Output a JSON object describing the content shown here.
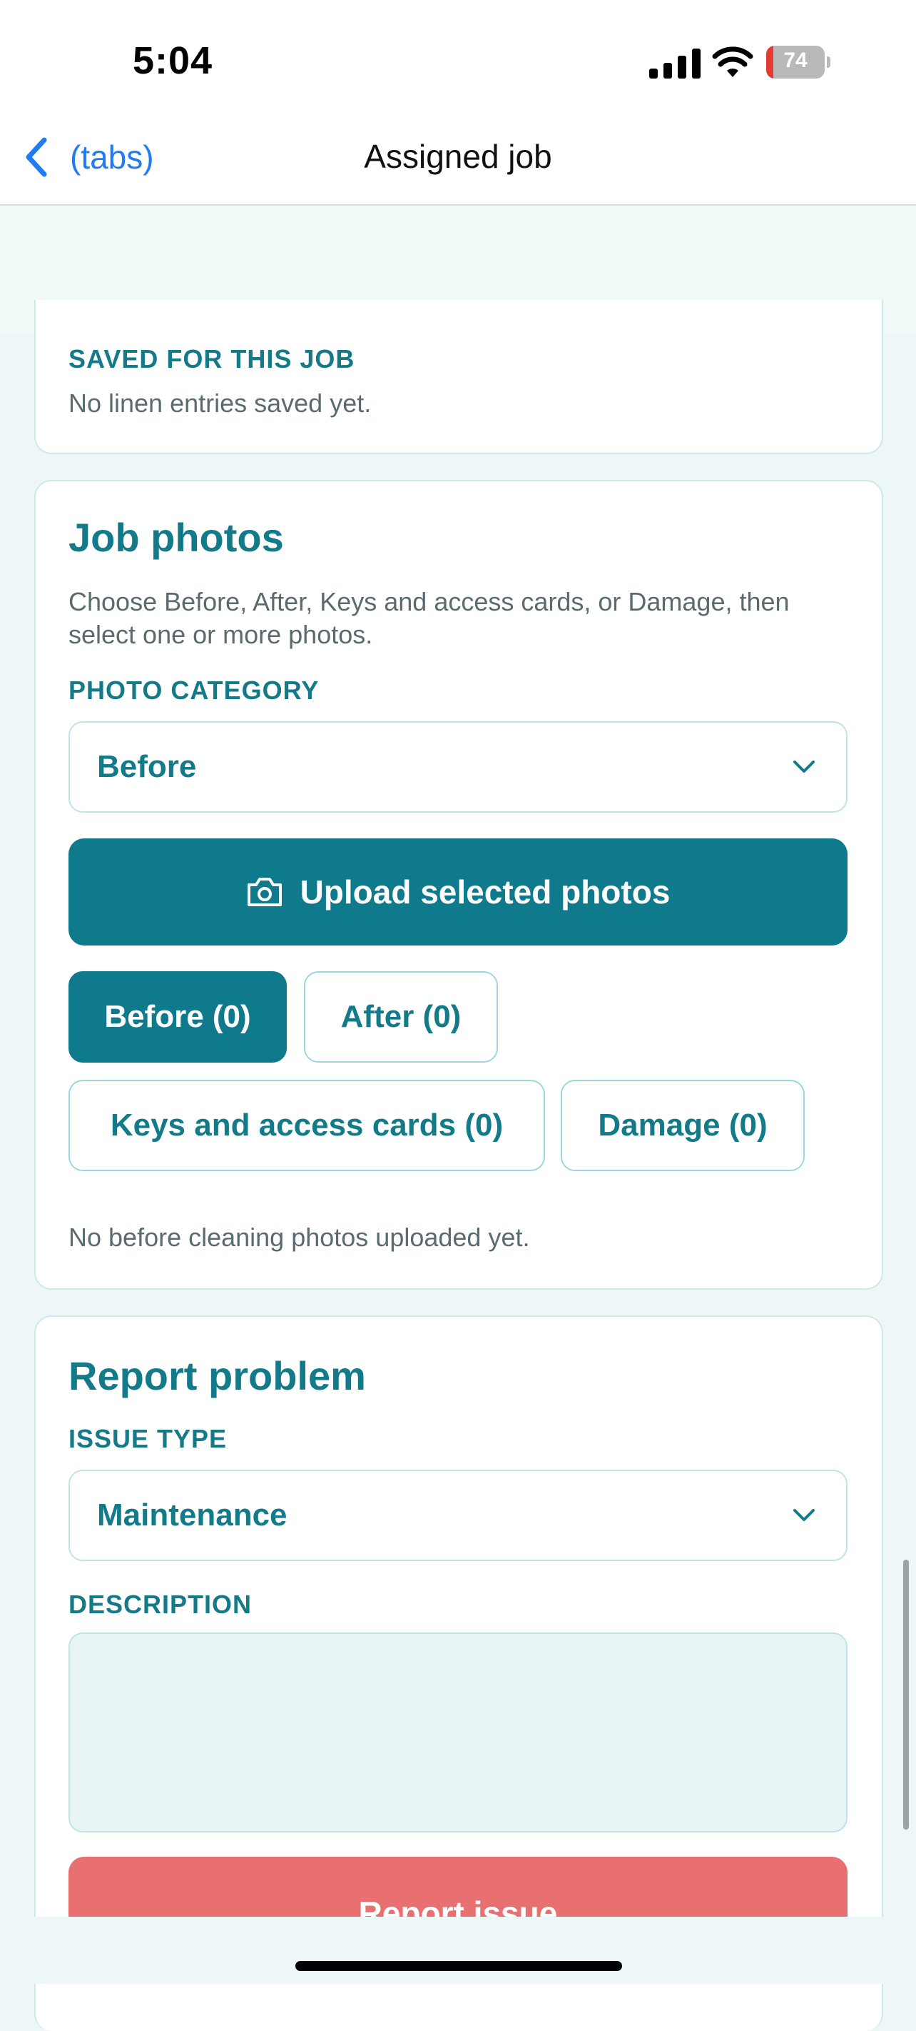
{
  "status_bar": {
    "time": "5:04",
    "battery": "74"
  },
  "nav": {
    "back_label": "(tabs)",
    "title": "Assigned job"
  },
  "saved_section": {
    "heading": "SAVED FOR THIS JOB",
    "empty_text": "No linen entries saved yet."
  },
  "job_photos": {
    "title": "Job photos",
    "description": "Choose Before, After, Keys and access cards, or Damage, then select one or more photos.",
    "category_label": "PHOTO CATEGORY",
    "category_value": "Before",
    "upload_label": "Upload selected photos",
    "chips": [
      {
        "label": "Before (0)",
        "active": true
      },
      {
        "label": "After (0)",
        "active": false
      },
      {
        "label": "Keys and access cards (0)",
        "active": false
      },
      {
        "label": "Damage (0)",
        "active": false
      }
    ],
    "empty_text": "No before cleaning photos uploaded yet."
  },
  "report_problem": {
    "title": "Report problem",
    "issue_label": "ISSUE TYPE",
    "issue_value": "Maintenance",
    "description_label": "DESCRIPTION",
    "description_value": "",
    "submit_label": "Report issue"
  },
  "colors": {
    "accent": "#0f7a8b",
    "link": "#1f7cf2",
    "danger": "#e97070"
  },
  "icons": [
    "chevron-left-icon",
    "chevron-down-icon",
    "camera-icon",
    "cellular-icon",
    "wifi-icon",
    "battery-icon"
  ]
}
